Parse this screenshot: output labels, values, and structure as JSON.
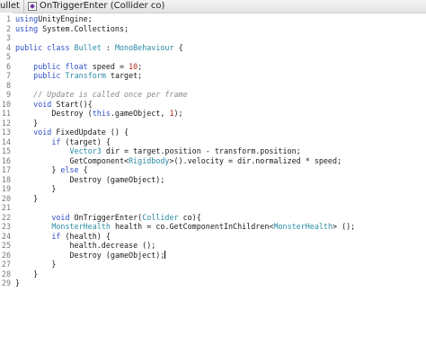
{
  "breadcrumb": {
    "file_label": "ullet",
    "method_label": "OnTriggerEnter (Collider co)"
  },
  "colors": {
    "keyword": "#2e4fc7",
    "type": "#2a8aa3",
    "number": "#b2221c",
    "comment": "#8a8a8a",
    "line_number": "#777777"
  },
  "editor": {
    "active_line": 25,
    "lines": [
      {
        "n": "1",
        "tokens": [
          [
            "kw",
            "using"
          ],
          [
            "",
            "UnityEngine;"
          ]
        ]
      },
      {
        "n": "2",
        "tokens": [
          [
            "kw",
            "using"
          ],
          [
            "",
            " System.Collections;"
          ]
        ]
      },
      {
        "n": "3",
        "tokens": []
      },
      {
        "n": "4",
        "tokens": [
          [
            "kw",
            "public class"
          ],
          [
            "",
            " "
          ],
          [
            "ty",
            "Bullet"
          ],
          [
            "",
            " : "
          ],
          [
            "ty",
            "MonoBehaviour"
          ],
          [
            "",
            " {"
          ]
        ]
      },
      {
        "n": "5",
        "tokens": []
      },
      {
        "n": "6",
        "tokens": [
          [
            "",
            "    "
          ],
          [
            "kw",
            "public float"
          ],
          [
            "",
            " speed = "
          ],
          [
            "num",
            "10"
          ],
          [
            "",
            ";"
          ]
        ]
      },
      {
        "n": "7",
        "tokens": [
          [
            "",
            "    "
          ],
          [
            "kw",
            "public"
          ],
          [
            "",
            " "
          ],
          [
            "ty",
            "Transform"
          ],
          [
            "",
            " target;"
          ]
        ]
      },
      {
        "n": "8",
        "tokens": []
      },
      {
        "n": "9",
        "tokens": [
          [
            "",
            "    "
          ],
          [
            "cm",
            "// Update is called once per frame"
          ]
        ]
      },
      {
        "n": "10",
        "tokens": [
          [
            "",
            "    "
          ],
          [
            "kw",
            "void"
          ],
          [
            "",
            " Start(){"
          ]
        ]
      },
      {
        "n": "11",
        "tokens": [
          [
            "",
            "        Destroy ("
          ],
          [
            "kw",
            "this"
          ],
          [
            "",
            ".gameObject, "
          ],
          [
            "num",
            "1"
          ],
          [
            "",
            ");"
          ]
        ]
      },
      {
        "n": "12",
        "tokens": [
          [
            "",
            "    }"
          ]
        ]
      },
      {
        "n": "13",
        "tokens": [
          [
            "",
            "    "
          ],
          [
            "kw",
            "void"
          ],
          [
            "",
            " FixedUpdate () {"
          ]
        ]
      },
      {
        "n": "14",
        "tokens": [
          [
            "",
            "        "
          ],
          [
            "kw",
            "if"
          ],
          [
            "",
            " (target) {"
          ]
        ]
      },
      {
        "n": "15",
        "tokens": [
          [
            "",
            "            "
          ],
          [
            "ty",
            "Vector3"
          ],
          [
            "",
            " dir = target.position - transform.position;"
          ]
        ]
      },
      {
        "n": "16",
        "tokens": [
          [
            "",
            "            GetComponent<"
          ],
          [
            "ty",
            "Rigidbody"
          ],
          [
            "",
            ">().velocity = dir.normalized * speed;"
          ]
        ]
      },
      {
        "n": "17",
        "tokens": [
          [
            "",
            "        } "
          ],
          [
            "kw",
            "else"
          ],
          [
            "",
            " {"
          ]
        ]
      },
      {
        "n": "18",
        "tokens": [
          [
            "",
            "            Destroy (gameObject);"
          ]
        ]
      },
      {
        "n": "19",
        "tokens": [
          [
            "",
            "        }"
          ]
        ]
      },
      {
        "n": "20",
        "tokens": [
          [
            "",
            "    }"
          ]
        ]
      },
      {
        "n": "21",
        "tokens": []
      },
      {
        "n": "22",
        "tokens": [
          [
            "",
            "        "
          ],
          [
            "kw",
            "void"
          ],
          [
            "",
            " OnTriggerEnter("
          ],
          [
            "ty",
            "Collider"
          ],
          [
            "",
            " co){"
          ]
        ]
      },
      {
        "n": "23",
        "tokens": [
          [
            "",
            "        "
          ],
          [
            "ty",
            "MonsterHealth"
          ],
          [
            "",
            " health = co.GetComponentInChildren<"
          ],
          [
            "ty",
            "MonsterHealth"
          ],
          [
            "",
            "> ();"
          ]
        ]
      },
      {
        "n": "24",
        "tokens": [
          [
            "",
            "        "
          ],
          [
            "kw",
            "if"
          ],
          [
            "",
            " (health) {"
          ]
        ]
      },
      {
        "n": "25",
        "tokens": [
          [
            "",
            "            health.decrease ();"
          ]
        ]
      },
      {
        "n": "26",
        "tokens": [
          [
            "",
            "            Destroy (gameObject);"
          ]
        ],
        "caret": true
      },
      {
        "n": "27",
        "tokens": [
          [
            "",
            "        }"
          ]
        ]
      },
      {
        "n": "28",
        "tokens": [
          [
            "",
            "    }"
          ]
        ]
      },
      {
        "n": "29",
        "tokens": [
          [
            "",
            "}"
          ]
        ]
      }
    ]
  }
}
